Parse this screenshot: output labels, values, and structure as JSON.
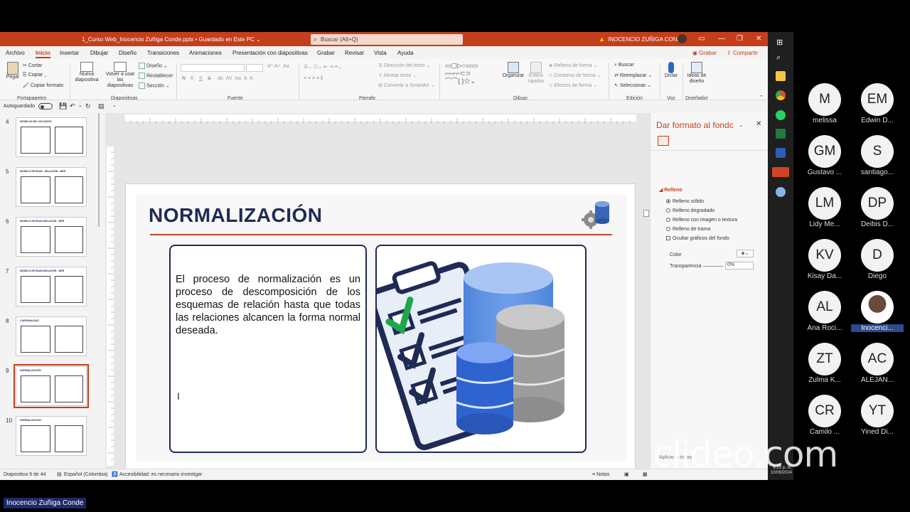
{
  "titlebar": {
    "doc_title": "1_Curso Web_Inocencio Zuñiga Conde.pptx • Guardado en Este PC ⌄",
    "search_placeholder": "Buscar (Alt+Q)",
    "user": "INOCENCIO ZUÑIGA CONDE"
  },
  "menu": [
    "Archivo",
    "Inicio",
    "Insertar",
    "Dibujar",
    "Diseño",
    "Transiciones",
    "Animaciones",
    "Presentación con diapositivas",
    "Grabar",
    "Revisar",
    "Vista",
    "Ayuda"
  ],
  "menu_actions": {
    "record": "Grabar",
    "share": "Compartir"
  },
  "ribbon": {
    "clipboard": {
      "paste": "Pegar",
      "cut": "Cortar",
      "copy": "Copiar",
      "format_painter": "Copiar formato",
      "group": "Portapapeles"
    },
    "slides": {
      "new_slide": "Nueva diapositiva",
      "reuse": "Volver a usar las diapositivas",
      "layout": "Diseño",
      "reset": "Restablecer",
      "section": "Sección",
      "group": "Diapositivas"
    },
    "font": {
      "group": "Fuente",
      "bold": "N",
      "italic": "K",
      "underline": "S",
      "strike": "S"
    },
    "paragraph": {
      "text_direction": "Dirección del texto",
      "align_text": "Alinear texto",
      "smartart": "Convertir a SmartArt",
      "group": "Párrafo"
    },
    "drawing": {
      "arrange": "Organizar",
      "quick_styles": "Estilos rápidos",
      "fill": "Relleno de forma",
      "outline": "Contorno de forma",
      "effects": "Efectos de forma",
      "group": "Dibujo"
    },
    "editing": {
      "find": "Buscar",
      "replace": "Reemplazar",
      "select": "Seleccionar",
      "group": "Edición"
    },
    "voice": {
      "dictate": "Dictar",
      "group": "Voz"
    },
    "designer": {
      "ideas": "Ideas de diseño",
      "group": "Diseñador"
    }
  },
  "qat": {
    "autosave": "Autoguardado"
  },
  "thumbnails": [
    {
      "num": "4",
      "title": "MODELOS DE LOS DATOS"
    },
    {
      "num": "5",
      "title": "MODELO ENTIDAD - RELACIÓN - MER"
    },
    {
      "num": "6",
      "title": "MODELO ENTIDAD-RELACIÓN - MER"
    },
    {
      "num": "7",
      "title": "MODELO ENTIDAD-RELACIÓN - MER"
    },
    {
      "num": "8",
      "title": "CARDINALIDAD"
    },
    {
      "num": "9",
      "title": "NORMALIZACIÓN"
    },
    {
      "num": "10",
      "title": "NORMALIZACIÓN"
    }
  ],
  "slide": {
    "title": "NORMALIZACIÓN",
    "body": "El proceso de normalización es un proceso de descomposición de los esquemas de relación hasta que todas las relaciones alcancen la forma normal deseada."
  },
  "format_pane": {
    "title": "Dar formato al fondc",
    "section": "Relleno",
    "options": [
      "Relleno sólido",
      "Relleno degradado",
      "Relleno con imagen o textura",
      "Relleno de trama"
    ],
    "hide_graphics": "Ocultar gráficos del fondo",
    "color_label": "Color",
    "transparency_label": "Transparencia",
    "transparency_value": "0%",
    "apply_all": "Aplicar a todas"
  },
  "status": {
    "slide_info": "Diapositiva 9 de 44",
    "language": "Español (Colombia)",
    "accessibility": "Accesibilidad: es necesario investigar",
    "notes": "Notas"
  },
  "clock": {
    "time": "8:29 p. m.",
    "date": "10/09/2024"
  },
  "participants": [
    {
      "initials": "M",
      "name": "melissa"
    },
    {
      "initials": "EM",
      "name": "Edwin D..."
    },
    {
      "initials": "GM",
      "name": "Gustavo ..."
    },
    {
      "initials": "S",
      "name": "santiago..."
    },
    {
      "initials": "LM",
      "name": "Lidy Me..."
    },
    {
      "initials": "DP",
      "name": "Deibis D..."
    },
    {
      "initials": "KV",
      "name": "Kisay Da..."
    },
    {
      "initials": "D",
      "name": "Diego"
    },
    {
      "initials": "AL",
      "name": "Ana Roci..."
    },
    {
      "initials": "",
      "name": "Inocenci..."
    },
    {
      "initials": "ZT",
      "name": "Zulma K..."
    },
    {
      "initials": "AC",
      "name": "ALEJAN..."
    },
    {
      "initials": "CR",
      "name": "Camilo ..."
    },
    {
      "initials": "YT",
      "name": "Yined Di..."
    }
  ],
  "speaker_name": "Inocencio Zuñiga Conde",
  "watermark": "clideo.com",
  "colors": {
    "accent": "#c43e1c",
    "title_navy": "#1f2a55",
    "title_rule": "#b8452b"
  }
}
